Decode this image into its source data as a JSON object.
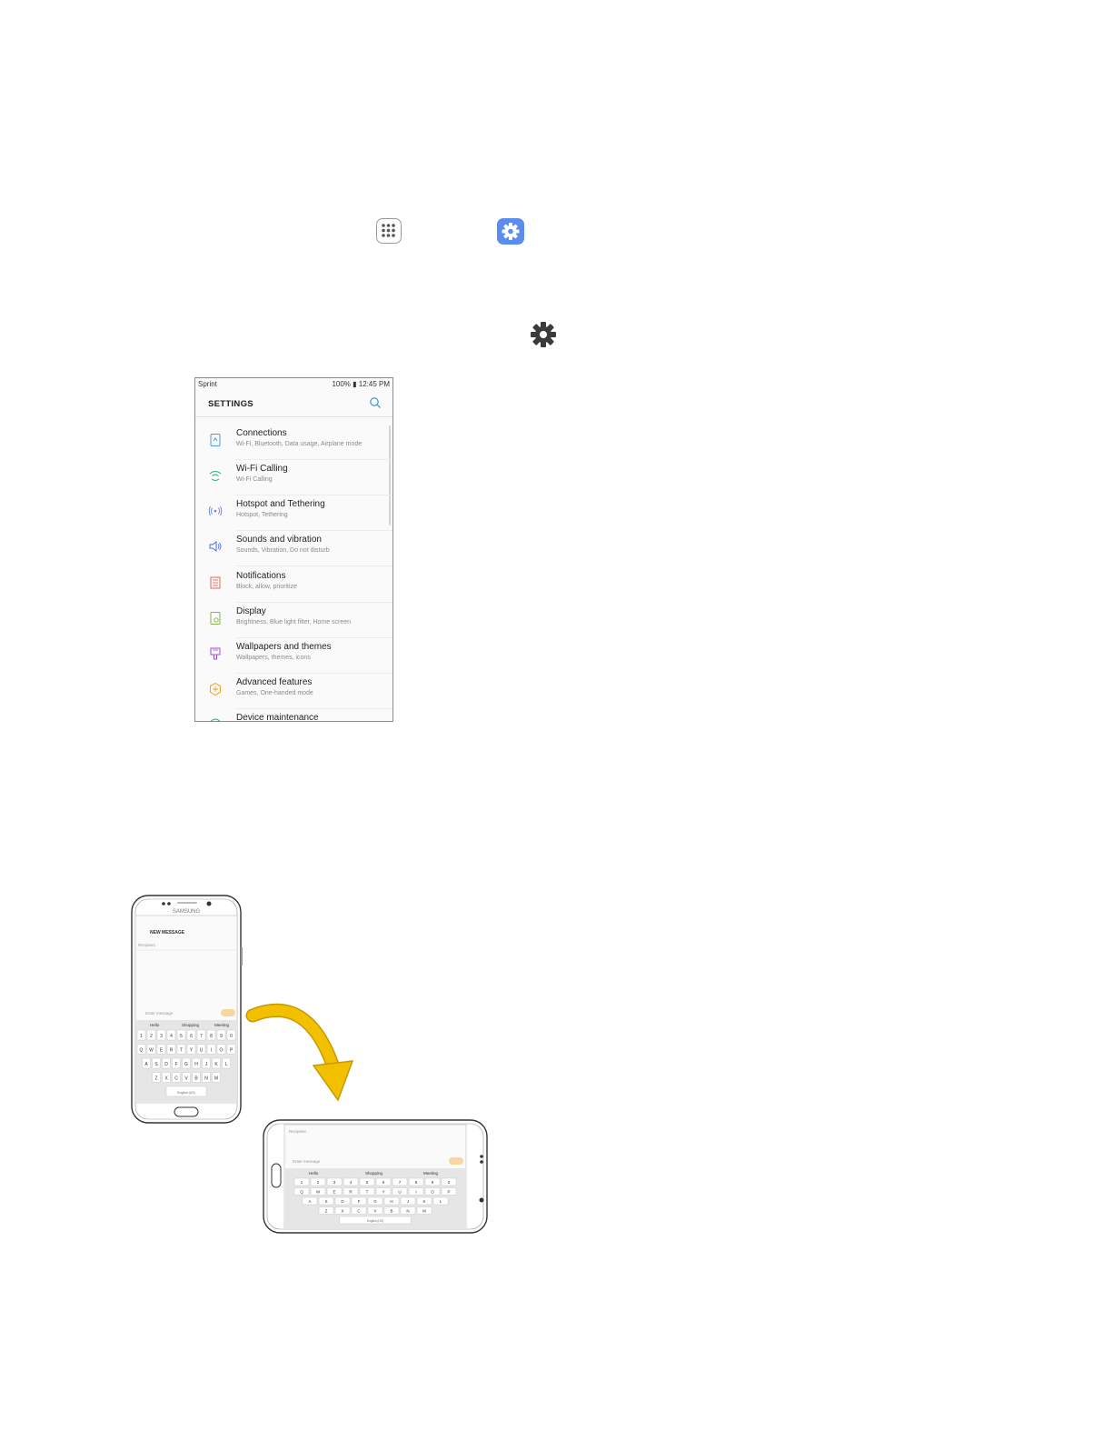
{
  "icons": {
    "apps": "apps-grid-icon",
    "settings_app": "settings-gear-app-icon",
    "settings_gear": "settings-gear-icon"
  },
  "colors": {
    "settings_app_bg": "#5b8def",
    "arrow_yellow": "#f3c000",
    "icon_blue": "#4a9bd8"
  },
  "settings_screen": {
    "carrier": "Sprint",
    "status_right": "100% ▮ 12:45 PM",
    "title": "SETTINGS",
    "items": [
      {
        "title": "Connections",
        "subtitle": "Wi-Fi, Bluetooth, Data usage, Airplane mode"
      },
      {
        "title": "Wi-Fi Calling",
        "subtitle": "Wi-Fi Calling"
      },
      {
        "title": "Hotspot and Tethering",
        "subtitle": "Hotspot, Tethering"
      },
      {
        "title": "Sounds and vibration",
        "subtitle": "Sounds, Vibration, Do not disturb"
      },
      {
        "title": "Notifications",
        "subtitle": "Block, allow, prioritize"
      },
      {
        "title": "Display",
        "subtitle": "Brightness, Blue light filter, Home screen"
      },
      {
        "title": "Wallpapers and themes",
        "subtitle": "Wallpapers, themes, icons"
      },
      {
        "title": "Advanced features",
        "subtitle": "Games, One-handed mode"
      },
      {
        "title": "Device maintenance",
        "subtitle": ""
      }
    ]
  },
  "rotation_illustration": {
    "brand": "SAMSUNG",
    "portrait_header": "NEW MESSAGE",
    "recipient_placeholder": "Recipient",
    "message_placeholder": "Enter message",
    "suggestions": [
      "Hello",
      "Shopping",
      "Meeting"
    ],
    "keyboard_rows": [
      [
        "1",
        "2",
        "3",
        "4",
        "5",
        "6",
        "7",
        "8",
        "9",
        "0"
      ],
      [
        "Q",
        "W",
        "E",
        "R",
        "T",
        "Y",
        "U",
        "I",
        "O",
        "P"
      ],
      [
        "A",
        "S",
        "D",
        "F",
        "G",
        "H",
        "J",
        "K",
        "L"
      ],
      [
        "Z",
        "X",
        "C",
        "V",
        "B",
        "N",
        "M"
      ]
    ],
    "space_label": "English (US)"
  }
}
